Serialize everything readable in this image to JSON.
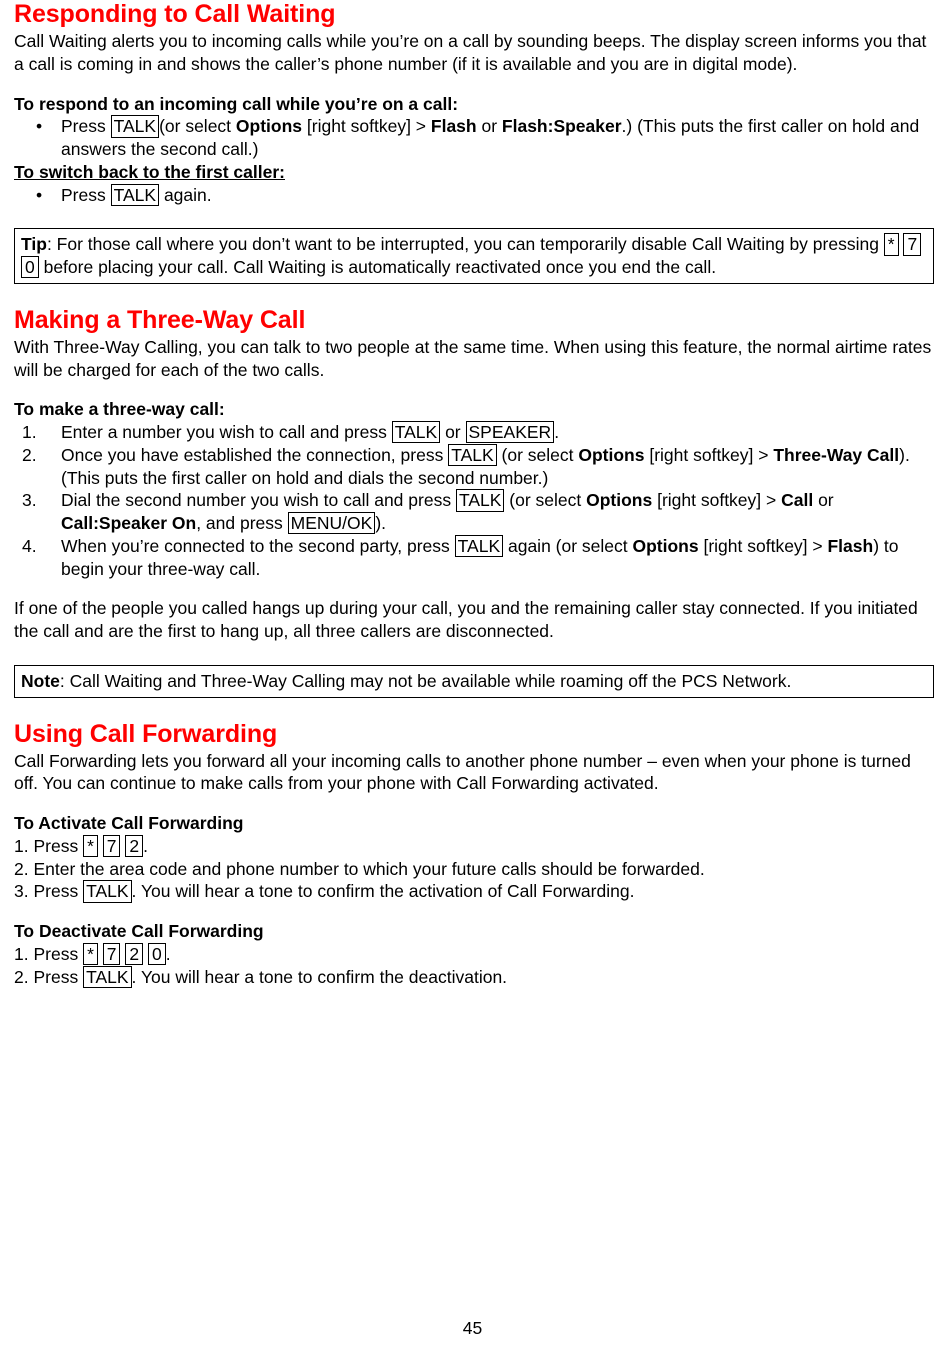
{
  "page": {
    "number": "45"
  },
  "sections": [
    {
      "id": "call-waiting",
      "heading": "Responding to Call Waiting",
      "intro": "Call Waiting alerts you to incoming calls while you’re on a call by sounding beeps. The display screen informs you that a call is coming in and shows the caller’s phone number (if it is available and you are in digital mode).",
      "sub1": "To respond to an incoming call while you’re on a call:",
      "bullet1_a": "Press ",
      "bullet1_key": "TALK ",
      "bullet1_b": "(or select ",
      "bullet1_bold1": "Options",
      "bullet1_c": " [right softkey] > ",
      "bullet1_bold2": "Flash",
      "bullet1_d": " or ",
      "bullet1_bold3": "Flash:Speaker",
      "bullet1_e": ".) (This puts the first caller on hold and answers the second call.)",
      "sub2": "To switch back to the first caller:",
      "bullet2_a": "Press ",
      "bullet2_key": "TALK",
      "bullet2_b": " again.",
      "tip_label": "Tip",
      "tip_a": ": For those call where you don’t want to be interrupted, you can temporarily disable Call Waiting by pressing ",
      "tip_key1": "*",
      "tip_key2": "7",
      "tip_key3": "0",
      "tip_b": " before placing your call. Call Waiting is automatically reactivated once you end the call."
    },
    {
      "id": "three-way-call",
      "heading": "Making a Three-Way Call",
      "intro": "With Three-Way Calling, you can talk to two people at the same time. When using this feature, the normal airtime rates will be charged for each of the two calls.",
      "sub1": "To make a three-way call:",
      "step1_a": "Enter a number you wish to call and press ",
      "step1_key1": "TALK",
      "step1_b": " or ",
      "step1_key2": "SPEAKER",
      "step1_c": ".",
      "step2_a": "Once you have established the connection, press ",
      "step2_key1": "TALK",
      "step2_b": " (or select ",
      "step2_bold1": "Options",
      "step2_c": " [right softkey] > ",
      "step2_bold2": "Three-Way Call",
      "step2_d": "). (This puts the first caller on hold and dials the second number.)",
      "step3_a": "Dial the second number you wish to call and press ",
      "step3_key1": "TALK",
      "step3_b": " (or select ",
      "step3_bold1": "Options",
      "step3_c": " [right softkey] > ",
      "step3_bold2": "Call",
      "step3_d": " or ",
      "step3_bold3": "Call:Speaker On",
      "step3_e": ", and press ",
      "step3_key2": "MENU/OK",
      "step3_f": ").",
      "step4_a": "When you’re connected to the second party, press ",
      "step4_key1": "TALK",
      "step4_b": " again (or select ",
      "step4_bold1": "Options",
      "step4_c": " [right softkey] > ",
      "step4_bold2": "Flash",
      "step4_d": ") to begin your three-way call.",
      "outro": "If one of the people you called hangs up during your call, you and the remaining caller stay connected. If you initiated the call and are the first to hang up, all three callers are disconnected.",
      "note_label": "Note",
      "note_text": ": Call Waiting and Three-Way Calling may not be available while roaming off the PCS Network."
    },
    {
      "id": "call-forwarding",
      "heading": "Using Call Forwarding",
      "intro": "Call Forwarding lets you forward all your incoming calls to another phone number – even when your phone is turned off. You can continue to make calls from your phone with Call Forwarding activated.",
      "sub1": "To Activate Call Forwarding",
      "act1_a": "1. Press ",
      "act1_key1": "*",
      "act1_key2": "7",
      "act1_key3": "2",
      "act1_b": ".",
      "act2": "2. Enter the area code and phone number to which your future calls should be forwarded.",
      "act3_a": "3. Press ",
      "act3_key1": "TALK",
      "act3_b": ". You will hear a tone to confirm the activation of Call Forwarding.",
      "sub2": "To Deactivate Call Forwarding",
      "deact1_a": "1. Press ",
      "deact1_key1": "*",
      "deact1_key2": "7",
      "deact1_key3": "2",
      "deact1_key4": "0",
      "deact1_b": ".",
      "deact2_a": "2. Press ",
      "deact2_key1": "TALK",
      "deact2_b": ". You will hear a tone to confirm the deactivation."
    }
  ],
  "colors": {
    "heading": "#ff0000",
    "text": "#000000",
    "background": "#ffffff"
  },
  "bullet_glyph": "•"
}
